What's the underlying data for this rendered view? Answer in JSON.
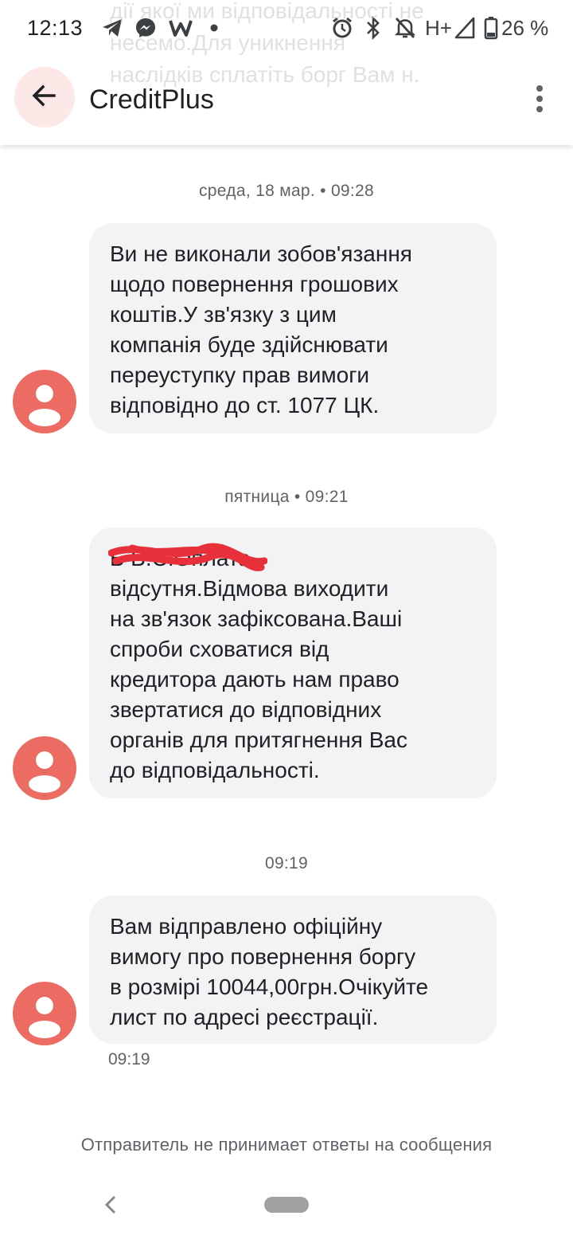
{
  "status_bar": {
    "time": "12:13",
    "network": "H+",
    "battery": "26 %",
    "icons": [
      "telegram-icon",
      "messenger-icon",
      "w-app-icon",
      "notification-dot-icon",
      "alarm-icon",
      "bluetooth-icon",
      "mute-icon",
      "signal-icon",
      "battery-icon"
    ]
  },
  "background_overlay": "дії якої ми відповідальності не несемо.Для уникнення наслідків сплатіть борг Вам н.",
  "app_bar": {
    "title": "CreditPlus",
    "back_icon": "arrow-back-icon",
    "menu_icon": "more-vert-icon"
  },
  "conversation": [
    {
      "separator": "среда, 18 мар. • 09:28",
      "text": "Ви не виконали зобов'язання\nщодо повернення грошових\nкоштів.У зв'язку з цим\nкомпанія буде здійснювати\nпереуступку прав вимоги\nвідповідно до ст. 1077 ЦК."
    },
    {
      "separator": "пятница • 09:21",
      "text": "Б      В.С.Оплата\nвідсутня.Відмова виходити\nна зв'язок зафіксована.Ваші\nспроби сховатися від\nкредитора дають нам право\nзвертатися до відповідних\nорганів для притягнення Вас\nдо відповідальності."
    },
    {
      "separator": "09:19",
      "text": "Вам відправлено офіційну\nвимогу про повернення боргу\nв розмірі 10044,00грн.Очікуйте\nлист по адресі реєстрації.",
      "timestamp": "09:19"
    }
  ],
  "footer": {
    "note": "Отправитель не принимает ответы на сообщения"
  },
  "colors": {
    "avatar": "#ec6c64",
    "bubble": "#f1f3f4",
    "redaction": "#e8303a",
    "back_button_bg": "#fce8e6"
  }
}
